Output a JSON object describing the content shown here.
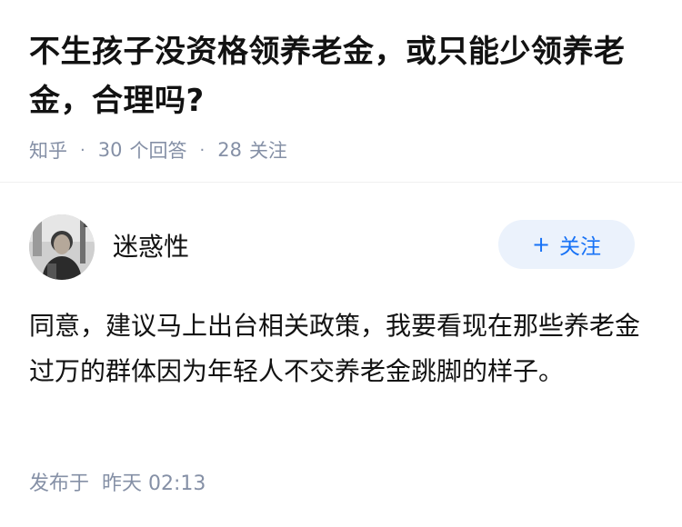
{
  "question": {
    "title": "不生孩子没资格领养老金，或只能少领养老金，合理吗?",
    "source": "知乎",
    "answer_count": "30",
    "answer_label": "个回答",
    "follow_count": "28",
    "follow_label": "关注"
  },
  "answer": {
    "author_name": "迷惑性",
    "follow_button": {
      "icon": "plus-icon",
      "label": "关注"
    },
    "content": "同意，建议马上出台相关政策，我要看现在那些养老金过万的群体因为年轻人不交养老金跳脚的样子。",
    "published_label": "发布于",
    "published_time": "昨天 02:13"
  },
  "colors": {
    "meta_gray": "#8590a6",
    "accent_blue": "#1772f6",
    "button_bg": "#ebf2fc"
  }
}
